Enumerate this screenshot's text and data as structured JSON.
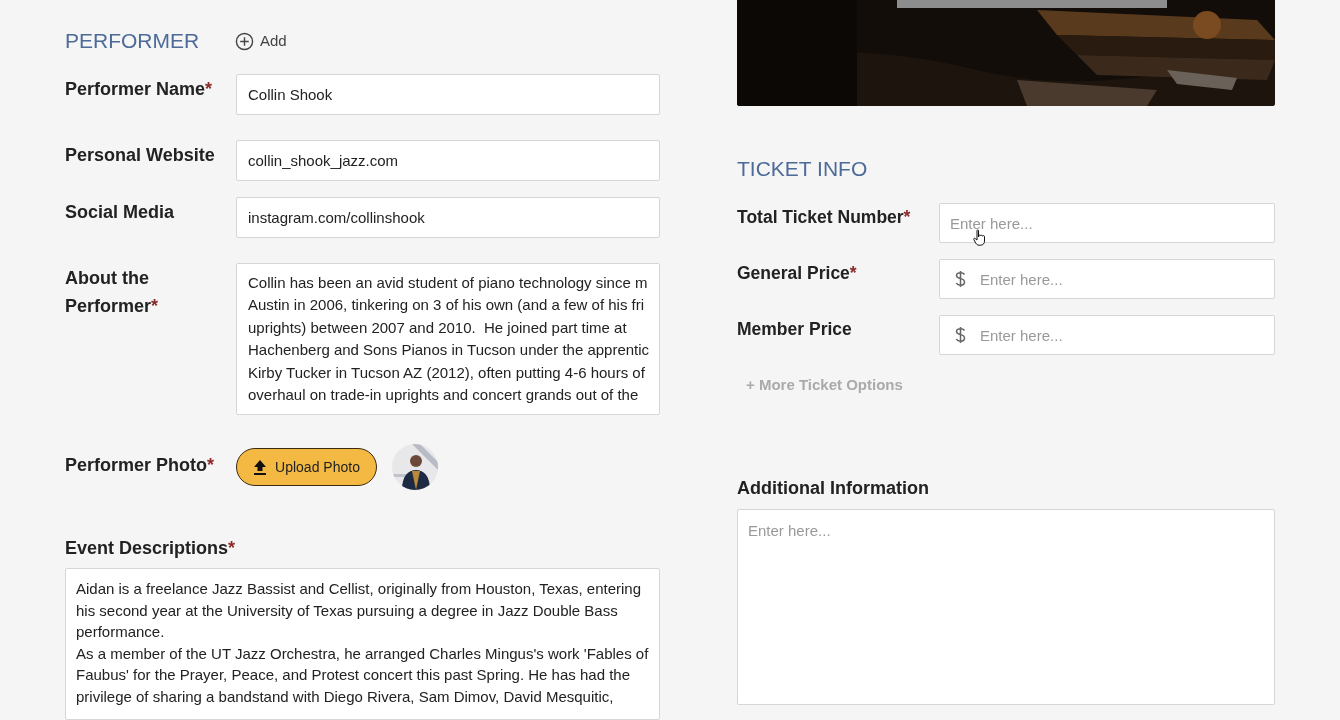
{
  "required_mark": "*",
  "performer": {
    "heading": "PERFORMER",
    "add_label": "Add",
    "fields": [
      {
        "kind": "input",
        "label": "Performer Name",
        "required": true,
        "value": "Collin Shook"
      },
      {
        "kind": "input",
        "label": "Personal Website",
        "required": false,
        "value": "collin_shook_jazz.com"
      },
      {
        "kind": "input",
        "label": "Social Media",
        "required": false,
        "value": "instagram.com/collinshook"
      },
      {
        "kind": "textarea",
        "label": "About the Performer",
        "required": true,
        "lines": [
          "Collin has been an avid student of piano technology since m",
          "Austin in 2006, tinkering on 3 of his own (and a few of his fri",
          "uprights) between 2007 and 2010.  He joined part time at",
          "Hachenberg and Sons Pianos in Tucson under the apprentic",
          "Kirby Tucker in Tucson AZ (2012), often putting 4-6 hours of",
          "overhaul on trade-in uprights and concert grands out of the"
        ]
      },
      {
        "label": "Performer Photo",
        "required": true,
        "button": "Upload Photo"
      }
    ]
  },
  "event_descriptions": {
    "label": "Event Descriptions",
    "required": true,
    "lines": [
      "Aidan is a freelance Jazz Bassist and Cellist, originally from Houston, Texas, entering",
      "his second year at the University of Texas pursuing a degree in Jazz Double Bass",
      "performance.",
      "As a member of the UT Jazz Orchestra, he arranged Charles Mingus's work 'Fables of",
      "Faubus' for the Prayer, Peace, and Protest concert this past Spring. He has had the",
      "privilege of sharing a bandstand with Diego Rivera, Sam Dimov, David Mesquitic,"
    ]
  },
  "ticket_info": {
    "heading": "TICKET INFO",
    "fields": [
      {
        "label": "Total Ticket Number",
        "required": true,
        "placeholder": "Enter here...",
        "currency": false
      },
      {
        "label": "General Price",
        "required": true,
        "placeholder": "Enter here...",
        "currency": true
      },
      {
        "label": "Member Price",
        "required": false,
        "placeholder": "Enter here...",
        "currency": true
      }
    ],
    "more_link": "+ More Ticket Options"
  },
  "additional_information": {
    "label": "Additional Information",
    "placeholder": "Enter here..."
  }
}
